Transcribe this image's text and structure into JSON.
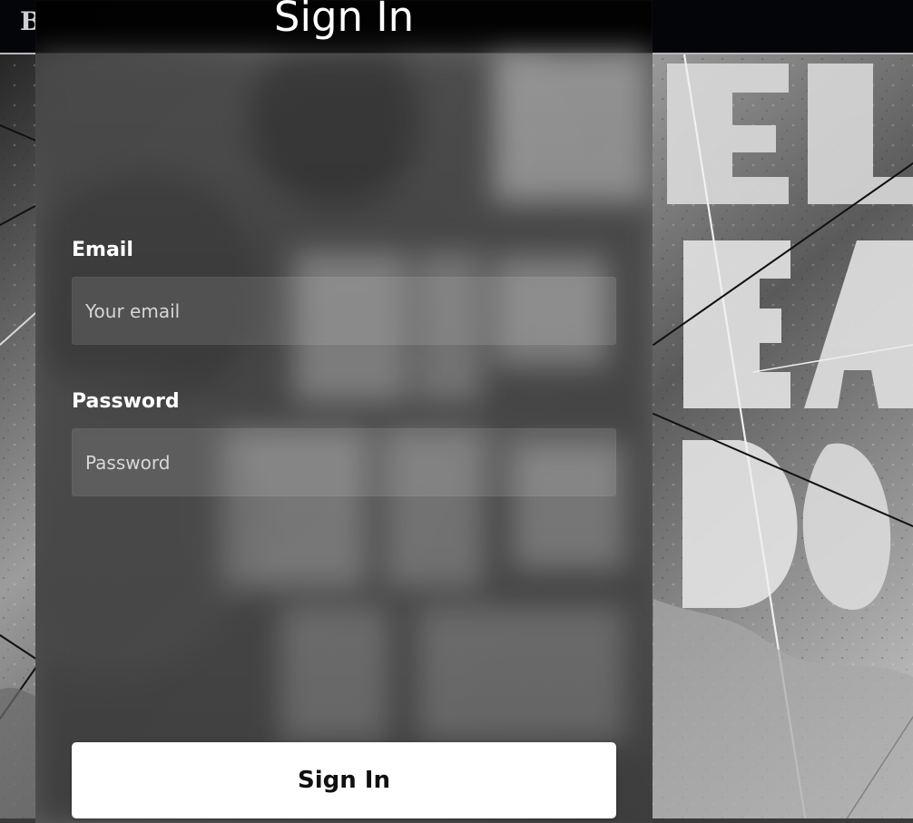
{
  "header": {
    "brand_text": "B"
  },
  "signin": {
    "title": "Sign In",
    "email_label": "Email",
    "email_placeholder": "Your email",
    "email_value": "",
    "password_label": "Password",
    "password_placeholder": "Password",
    "password_value": "",
    "submit_label": "Sign In"
  },
  "colors": {
    "topbar_background": "#040509",
    "panel_overlay": "#3a3a3a",
    "button_background": "#ffffff",
    "button_text": "#101010",
    "label_text": "#ffffff"
  }
}
